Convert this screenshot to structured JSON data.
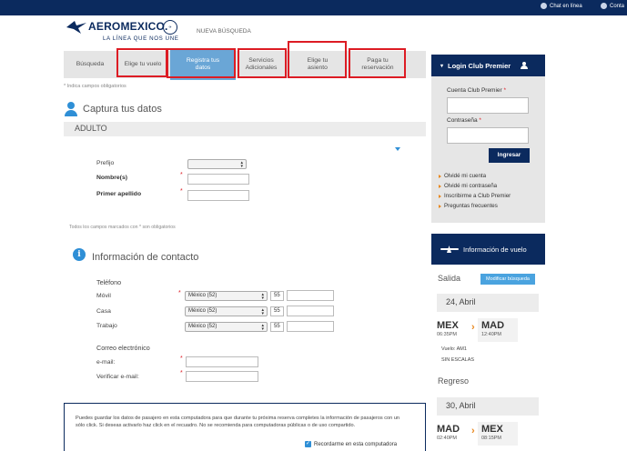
{
  "topbar": {
    "chat": "Chat en línea",
    "contact": "Conta"
  },
  "brand": {
    "name": "AEROMEXICO.",
    "tagline": "LA LÍNEA QUE NOS UNE"
  },
  "header": {
    "new_search": "NUEVA BÚSQUEDA"
  },
  "steps": [
    {
      "line1": "Búsqueda",
      "line2": "",
      "active": false
    },
    {
      "line1": "Elige tu vuelo",
      "line2": "",
      "active": false
    },
    {
      "line1": "Registra tus",
      "line2": "datos",
      "active": true
    },
    {
      "line1": "Servicios",
      "line2": "Adicionales",
      "active": false
    },
    {
      "line1": "Elige tu",
      "line2": "asiento",
      "active": false
    },
    {
      "line1": "Paga tu",
      "line2": "reservación",
      "active": false
    }
  ],
  "required_note": "* Indica campos obligatorios",
  "capture": {
    "title": "Captura tus datos",
    "adult_label": "ADULTO",
    "prefix_label": "Prefijo",
    "names_label": "Nombre(s)",
    "surname_label": "Primer apellido",
    "all_fields_note": "Todos los campos marcados con * son obligatorios"
  },
  "contact": {
    "info_glyph": "i",
    "title": "Información de contacto",
    "phone_label": "Teléfono",
    "phones": [
      {
        "label": "Móvil",
        "country": "México (52)",
        "code": "55"
      },
      {
        "label": "Casa",
        "country": "México (52)",
        "code": "55"
      },
      {
        "label": "Trabajo",
        "country": "México (52)",
        "code": "55"
      }
    ],
    "email_label": "Correo electrónico",
    "email_field": "e-mail:",
    "verify_email_field": "Verificar e-mail:"
  },
  "save_box": {
    "text": "Puedes guardar los datos de pasajero en esta computadora para que durante tu próxima reserva completes la información de pasajeros con un sólo click. Si deseas activarlo haz click en el recuadro. No se recomienda para computadoras públicas o de uso compartido.",
    "remember_label": "Recordarme en esta computadora"
  },
  "login": {
    "title": "Login Club Premier",
    "account_label": "Cuenta Club Premier",
    "password_label": "Contraseña",
    "submit": "Ingresar",
    "links": [
      "Olvidé mi cuenta",
      "Olvidé mi contraseña",
      "Inscribirme a Club Premier",
      "Preguntas frecuentes"
    ]
  },
  "flight": {
    "title": "Información de vuelo",
    "outbound_label": "Salida",
    "modify": "Modificar búsqueda",
    "outbound_date": "24, Abril",
    "outbound_from": "MEX",
    "outbound_from_time": "06:35PM",
    "outbound_to": "MAD",
    "outbound_to_time": "12:40PM",
    "flight_no": "Vuelo: AM1",
    "stops": "SIN ESCALAS",
    "return_label": "Regreso",
    "return_date": "30, Abril",
    "return_from": "MAD",
    "return_from_time": "02:40PM",
    "return_to": "MEX",
    "return_to_time": "08:15PM"
  },
  "colors": {
    "navy": "#0b2a5e",
    "accent_blue": "#2f8fd6",
    "highlight_red": "#dd1c24",
    "orange": "#e8871e"
  }
}
